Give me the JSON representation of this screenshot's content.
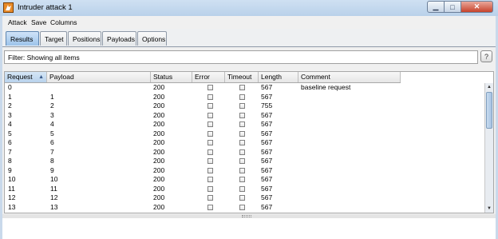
{
  "window": {
    "title": "Intruder attack 1"
  },
  "menu": [
    "Attack",
    "Save",
    "Columns"
  ],
  "tabs": [
    {
      "label": "Results",
      "active": true
    },
    {
      "label": "Target",
      "active": false
    },
    {
      "label": "Positions",
      "active": false
    },
    {
      "label": "Payloads",
      "active": false
    },
    {
      "label": "Options",
      "active": false
    }
  ],
  "filter": {
    "text": "Filter:  Showing all items"
  },
  "help_label": "?",
  "table": {
    "columns": [
      "Request",
      "Payload",
      "Status",
      "Error",
      "Timeout",
      "Length",
      "Comment"
    ],
    "sorted_column": "Request",
    "rows": [
      {
        "request": "0",
        "payload": "",
        "status": "200",
        "error": false,
        "timeout": false,
        "length": "567",
        "comment": "baseline request"
      },
      {
        "request": "1",
        "payload": "1",
        "status": "200",
        "error": false,
        "timeout": false,
        "length": "567",
        "comment": ""
      },
      {
        "request": "2",
        "payload": "2",
        "status": "200",
        "error": false,
        "timeout": false,
        "length": "755",
        "comment": ""
      },
      {
        "request": "3",
        "payload": "3",
        "status": "200",
        "error": false,
        "timeout": false,
        "length": "567",
        "comment": ""
      },
      {
        "request": "4",
        "payload": "4",
        "status": "200",
        "error": false,
        "timeout": false,
        "length": "567",
        "comment": ""
      },
      {
        "request": "5",
        "payload": "5",
        "status": "200",
        "error": false,
        "timeout": false,
        "length": "567",
        "comment": ""
      },
      {
        "request": "6",
        "payload": "6",
        "status": "200",
        "error": false,
        "timeout": false,
        "length": "567",
        "comment": ""
      },
      {
        "request": "7",
        "payload": "7",
        "status": "200",
        "error": false,
        "timeout": false,
        "length": "567",
        "comment": ""
      },
      {
        "request": "8",
        "payload": "8",
        "status": "200",
        "error": false,
        "timeout": false,
        "length": "567",
        "comment": ""
      },
      {
        "request": "9",
        "payload": "9",
        "status": "200",
        "error": false,
        "timeout": false,
        "length": "567",
        "comment": ""
      },
      {
        "request": "10",
        "payload": "10",
        "status": "200",
        "error": false,
        "timeout": false,
        "length": "567",
        "comment": ""
      },
      {
        "request": "11",
        "payload": "11",
        "status": "200",
        "error": false,
        "timeout": false,
        "length": "567",
        "comment": ""
      },
      {
        "request": "12",
        "payload": "12",
        "status": "200",
        "error": false,
        "timeout": false,
        "length": "567",
        "comment": ""
      },
      {
        "request": "13",
        "payload": "13",
        "status": "200",
        "error": false,
        "timeout": false,
        "length": "567",
        "comment": ""
      }
    ]
  },
  "icons": {
    "app": "burp-icon",
    "minimize": "minimize-icon",
    "maximize": "maximize-icon",
    "close": "close-icon",
    "sort": "sort-ascending-icon"
  },
  "colors": {
    "accent": "#9cc3ea",
    "close": "#c7432c"
  }
}
